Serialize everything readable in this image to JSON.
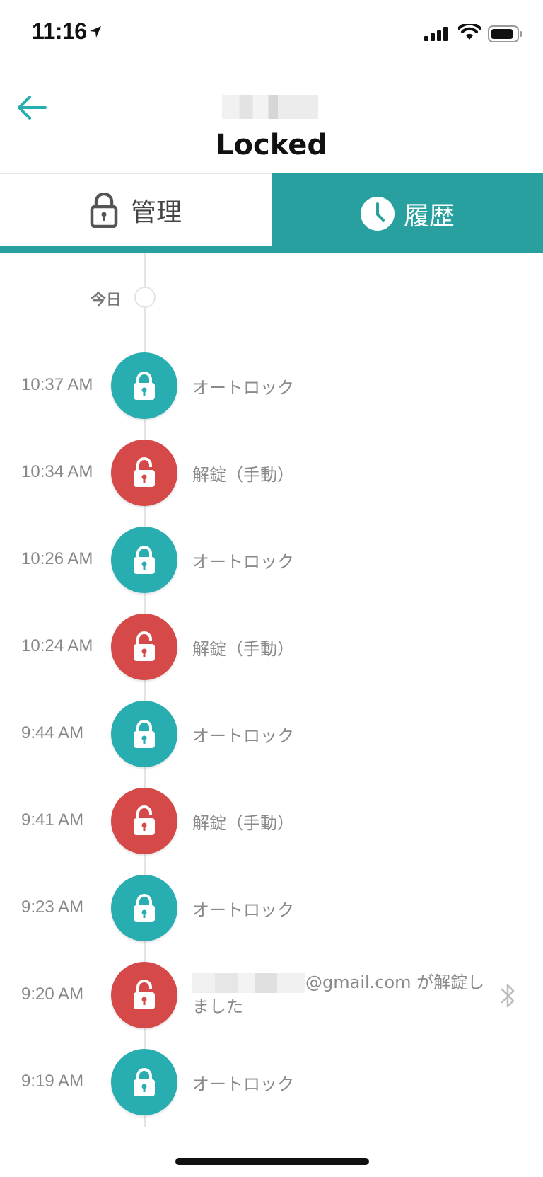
{
  "status_bar": {
    "time": "11:16"
  },
  "header": {
    "title": "Locked"
  },
  "tabs": {
    "manage": {
      "label": "管理"
    },
    "history": {
      "label": "履歴"
    }
  },
  "colors": {
    "accent": "#28a0a0",
    "locked": "#28aeb1",
    "unlocked": "#d54a49"
  },
  "timeline": {
    "day_label": "今日",
    "events": [
      {
        "time": "10:37 AM",
        "text": "オートロック",
        "state": "locked"
      },
      {
        "time": "10:34 AM",
        "text": "解錠（手動）",
        "state": "unlocked"
      },
      {
        "time": "10:26 AM",
        "text": "オートロック",
        "state": "locked"
      },
      {
        "time": "10:24 AM",
        "text": "解錠（手動）",
        "state": "unlocked"
      },
      {
        "time": "9:44 AM",
        "text": "オートロック",
        "state": "locked"
      },
      {
        "time": "9:41 AM",
        "text": "解錠（手動）",
        "state": "unlocked"
      },
      {
        "time": "9:23 AM",
        "text": "オートロック",
        "state": "locked"
      },
      {
        "time": "9:20 AM",
        "text_suffix": "@gmail.com が解錠し",
        "text_line2": "ました",
        "state": "unlocked",
        "icon": "bluetooth-icon"
      },
      {
        "time": "9:19 AM",
        "text": "オートロック",
        "state": "locked"
      }
    ]
  }
}
